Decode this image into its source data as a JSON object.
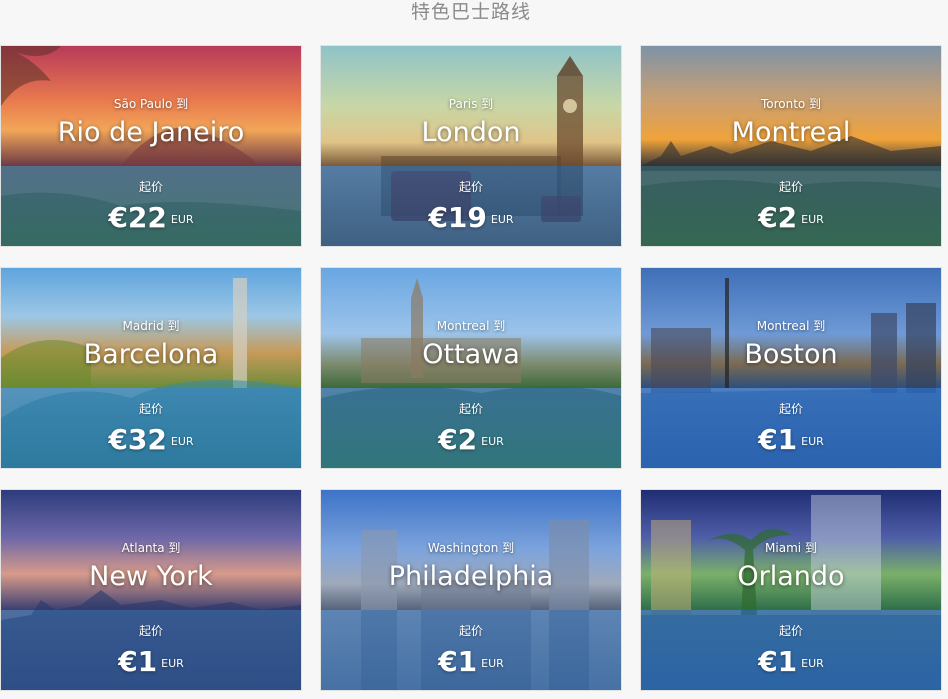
{
  "section": {
    "title": "特色巴士路线"
  },
  "routes": [
    {
      "origin": "São Paulo 到",
      "destination": "Rio de Janeiro",
      "from_label": "起价",
      "price": "€22",
      "currency": "EUR"
    },
    {
      "origin": "Paris 到",
      "destination": "London",
      "from_label": "起价",
      "price": "€19",
      "currency": "EUR"
    },
    {
      "origin": "Toronto 到",
      "destination": "Montreal",
      "from_label": "起价",
      "price": "€2",
      "currency": "EUR"
    },
    {
      "origin": "Madrid 到",
      "destination": "Barcelona",
      "from_label": "起价",
      "price": "€32",
      "currency": "EUR"
    },
    {
      "origin": "Montreal 到",
      "destination": "Ottawa",
      "from_label": "起价",
      "price": "€2",
      "currency": "EUR"
    },
    {
      "origin": "Montreal 到",
      "destination": "Boston",
      "from_label": "起价",
      "price": "€1",
      "currency": "EUR"
    },
    {
      "origin": "Atlanta 到",
      "destination": "New York",
      "from_label": "起价",
      "price": "€1",
      "currency": "EUR"
    },
    {
      "origin": "Washington 到",
      "destination": "Philadelphia",
      "from_label": "起价",
      "price": "€1",
      "currency": "EUR"
    },
    {
      "origin": "Miami 到",
      "destination": "Orlando",
      "from_label": "起价",
      "price": "€1",
      "currency": "EUR"
    }
  ]
}
